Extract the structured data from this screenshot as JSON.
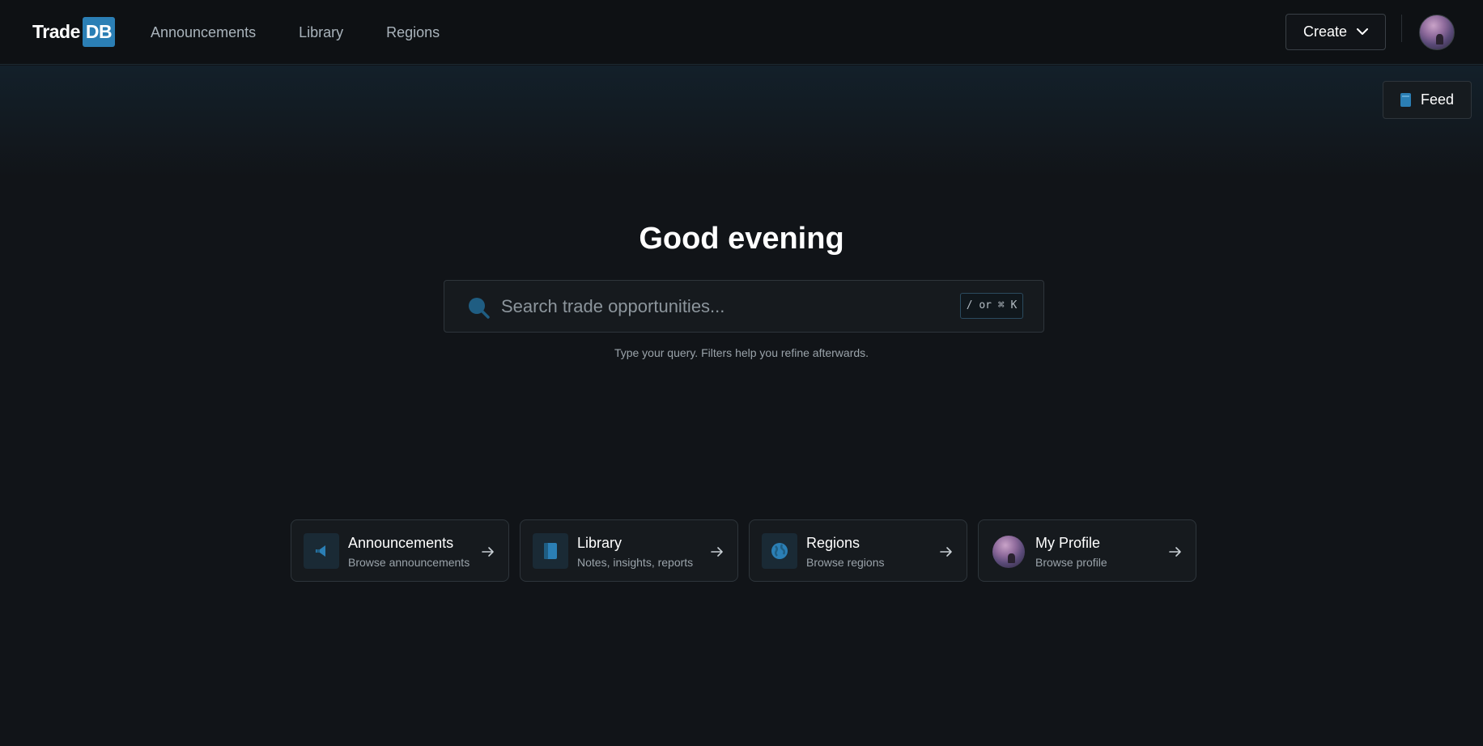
{
  "header": {
    "logo_text": "Trade",
    "logo_badge": "DB",
    "nav": [
      "Announcements",
      "Library",
      "Regions"
    ],
    "create_label": "Create",
    "avatar_icon": "user-avatar"
  },
  "feed": {
    "label": "Feed",
    "icon": "feed-icon"
  },
  "hero": {
    "greeting": "Good evening",
    "search_placeholder": "Search trade opportunities...",
    "shortcut": "/ or ⌘ K",
    "hint": "Type your query. Filters help you refine afterwards."
  },
  "cards": [
    {
      "title": "Announcements",
      "subtitle": "Browse announcements",
      "icon": "megaphone-icon"
    },
    {
      "title": "Library",
      "subtitle": "Notes, insights, reports",
      "icon": "book-icon"
    },
    {
      "title": "Regions",
      "subtitle": "Browse regions",
      "icon": "globe-icon"
    },
    {
      "title": "My Profile",
      "subtitle": "Browse profile",
      "icon": "profile-avatar"
    }
  ],
  "colors": {
    "background": "#111418",
    "accent": "#2b7fb5",
    "card_border": "#2e353b"
  }
}
